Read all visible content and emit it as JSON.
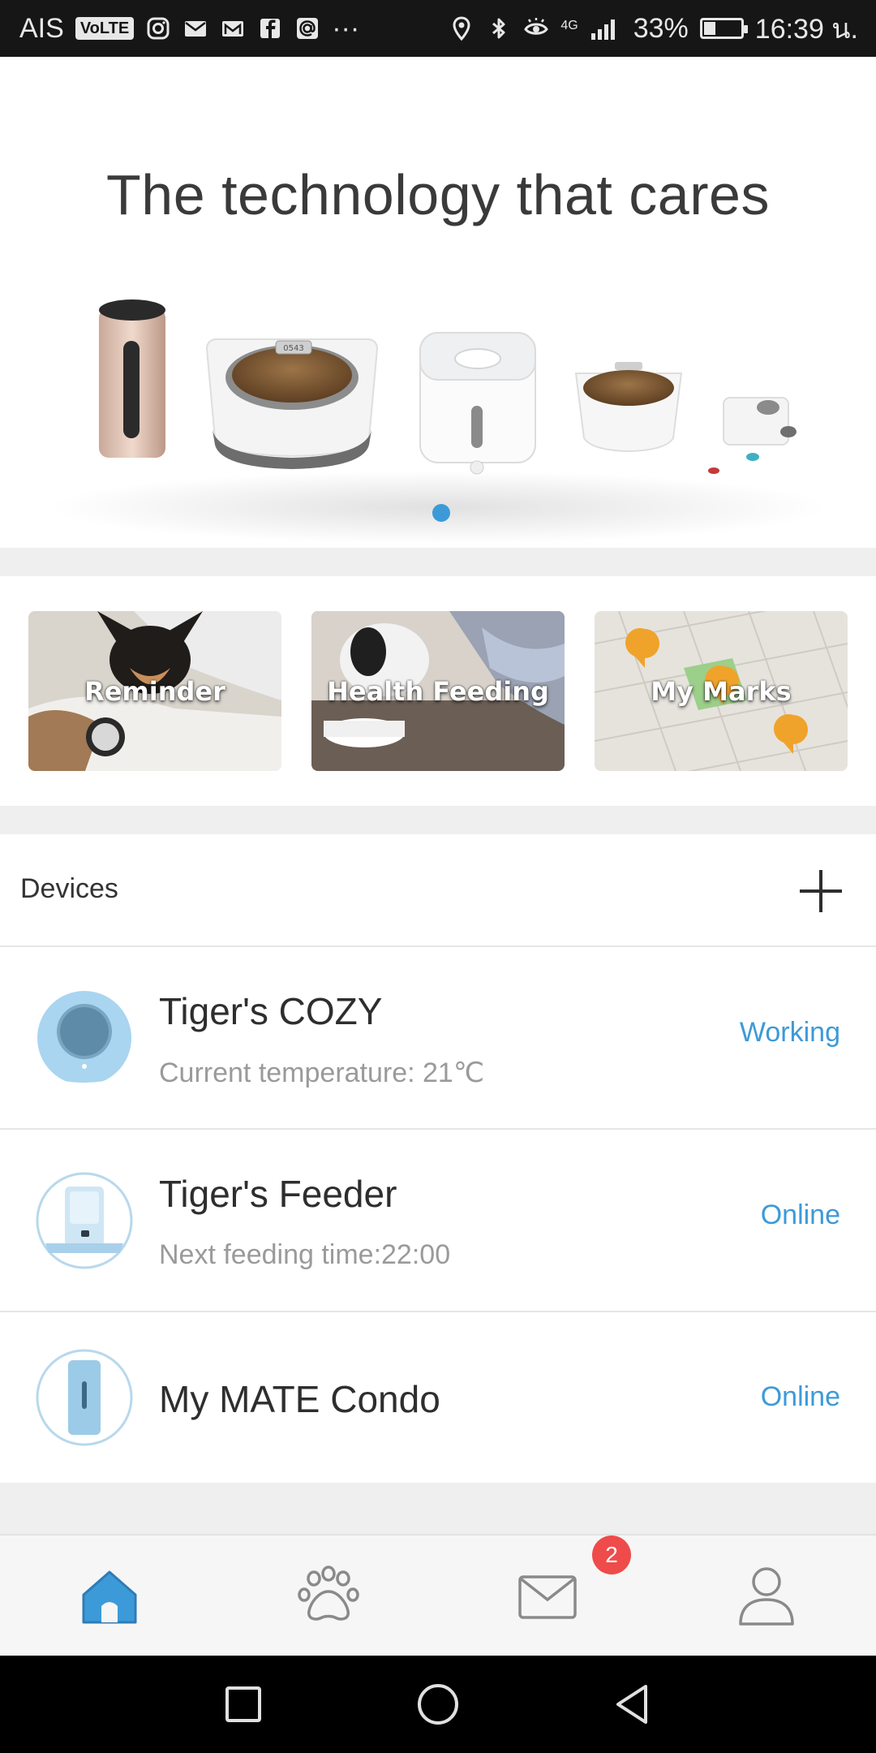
{
  "status_bar": {
    "carrier": "AIS",
    "volte_badge": "VoLTE",
    "more": "···",
    "network": "4G",
    "battery_percent_text": "33%",
    "battery_level": 0.33,
    "time": "16:39 น."
  },
  "hero": {
    "title": "The technology that cares",
    "carousel_page": 1
  },
  "features": [
    {
      "label": "Reminder"
    },
    {
      "label": "Health Feeding"
    },
    {
      "label": "My Marks"
    }
  ],
  "devices": {
    "title": "Devices",
    "items": [
      {
        "name": "Tiger's COZY",
        "detail": "Current temperature: 21℃",
        "status": "Working"
      },
      {
        "name": "Tiger's Feeder",
        "detail": "Next feeding time:22:00",
        "status": "Online"
      },
      {
        "name": "My MATE Condo",
        "detail": "",
        "status": "Online"
      }
    ]
  },
  "tab_bar": {
    "tabs": [
      {
        "name": "home-icon",
        "active": true
      },
      {
        "name": "paw-icon",
        "active": false
      },
      {
        "name": "mail-icon",
        "active": false
      },
      {
        "name": "profile-icon",
        "active": false
      }
    ],
    "mail_badge": "2"
  },
  "colors": {
    "accent": "#3d9ad8",
    "badge": "#ef4b4b",
    "text_primary": "#2e2e2e",
    "text_secondary": "#9a9a9a"
  }
}
